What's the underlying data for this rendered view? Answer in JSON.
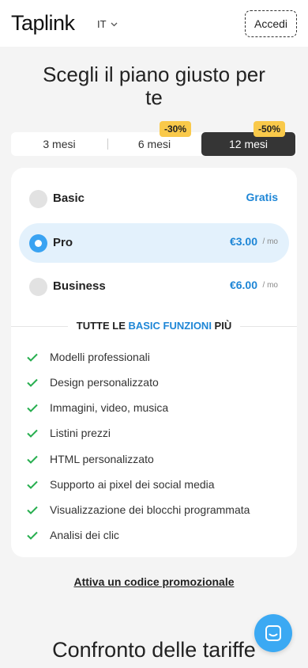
{
  "header": {
    "logo": "Taplink",
    "language": "IT",
    "login_label": "Accedi"
  },
  "title": "Scegli il piano giusto per te",
  "periods": [
    {
      "label": "3 mesi",
      "discount": "",
      "selected": false
    },
    {
      "label": "6 mesi",
      "discount": "-30%",
      "selected": false
    },
    {
      "label": "12 mesi",
      "discount": "-50%",
      "selected": true
    }
  ],
  "plans": [
    {
      "name": "Basic",
      "price": "Gratis",
      "unit": "",
      "selected": false
    },
    {
      "name": "Pro",
      "price": "€3.00",
      "unit": "/ mo",
      "selected": true
    },
    {
      "name": "Business",
      "price": "€6.00",
      "unit": "/ mo",
      "selected": false
    }
  ],
  "features_heading": {
    "prefix": "TUTTE LE ",
    "highlight": "BASIC FUNZIONI",
    "suffix": " PIÙ"
  },
  "features": [
    "Modelli professionali",
    "Design personalizzato",
    "Immagini, video, musica",
    "Listini prezzi",
    "HTML personalizzato",
    "Supporto ai pixel dei social media",
    "Visualizzazione dei blocchi programmata",
    "Analisi dei clic"
  ],
  "promo_link": "Attiva un codice promozionale",
  "compare_title": "Confronto delle tariffe",
  "colors": {
    "accent": "#1e86d6",
    "selected_bg": "#e3f1fc",
    "check": "#27ae4f",
    "discount_bg": "#f9c94a",
    "active_tab_bg": "#353535",
    "chat_button": "#3ba9f3"
  },
  "icons": {
    "language_caret": "chevron-down-icon",
    "feature_check": "check-icon",
    "chat": "chat-icon"
  }
}
